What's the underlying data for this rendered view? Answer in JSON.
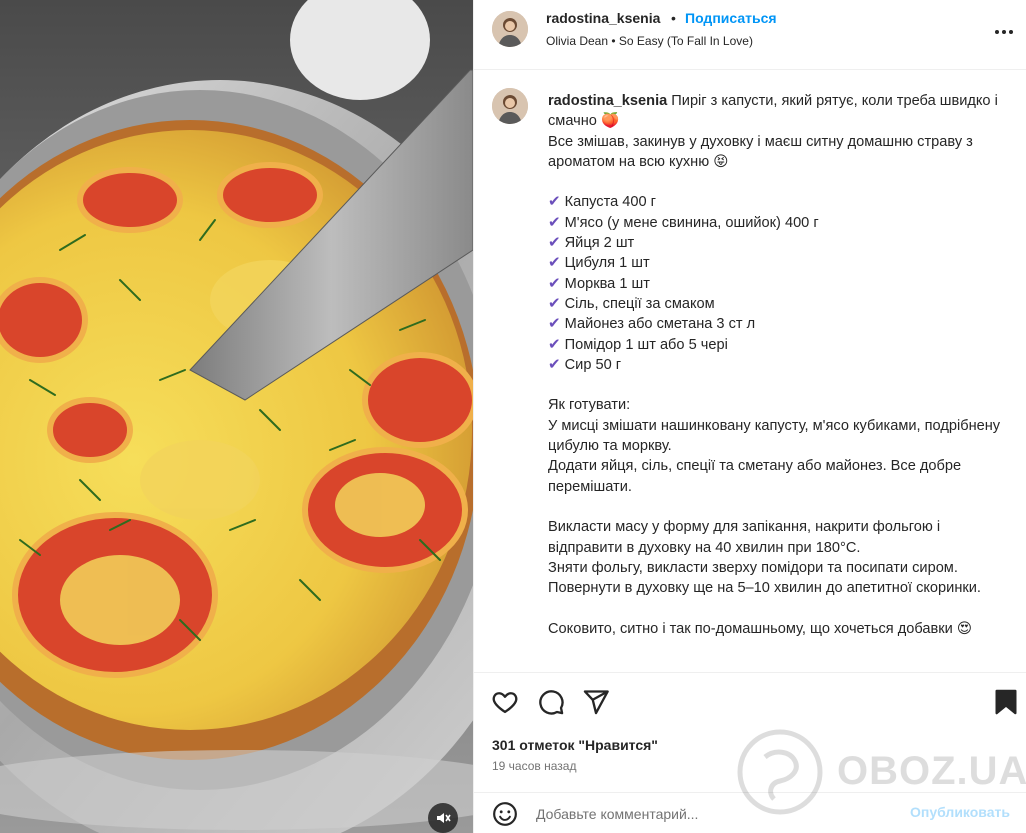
{
  "post": {
    "username": "radostina_ksenia",
    "separator": "•",
    "follow_label": "Подписаться",
    "music": "Olivia Dean • So Easy (To Fall In Love)"
  },
  "caption": {
    "username": "radostina_ksenia",
    "intro": " Пиріг з капусти, який рятує, коли треба швидко і смачно 🍑\nВсе змішав, закинув у духовку і маєш ситну домашню страву з ароматом на всю кухню 😝\n\n",
    "check_glyph": "✔",
    "ingredients": [
      "Капуста 400 г",
      "М'ясо (у мене свинина, ошийок) 400 г",
      "Яйця 2 шт",
      "Цибуля 1 шт",
      "Морква 1 шт",
      "Сіль, спеції за смаком",
      "Майонез або сметана 3 ст л",
      "Помідор 1 шт або 5 чері",
      "Сир 50 г"
    ],
    "method": "\nЯк готувати:\nУ мисці змішати нашинковану капусту, м'ясо кубиками, подрібнену цибулю та моркву.\nДодати яйця, сіль, спеції та сметану або майонез. Все добре перемішати.\n\nВикласти масу у форму для запікання, накрити фольгою і відправити в духовку на 40 хвилин при 180°C.\nЗняти фольгу, викласти зверху помідори та посипати сиром. Повернути в духовку ще на 5–10 хвилин до апетитної скоринки.\n\nСоковито, ситно і так по-домашньому, що хочеться добавки 😍"
  },
  "stats": {
    "likes": "301 отметок \"Нравится\"",
    "time": "19 часов назад"
  },
  "comment": {
    "placeholder": "Добавьте комментарий...",
    "post_label": "Опубликовать"
  },
  "watermark": "OBOZ.UA",
  "icons": [
    "more-icon",
    "heart-icon",
    "comment-icon",
    "share-icon",
    "bookmark-icon",
    "emoji-icon",
    "mute-icon"
  ],
  "colors": {
    "link": "#0095f6",
    "post_disabled": "#b2dffc",
    "check": "#6b4fbb",
    "text": "#262626",
    "muted": "#737373"
  }
}
